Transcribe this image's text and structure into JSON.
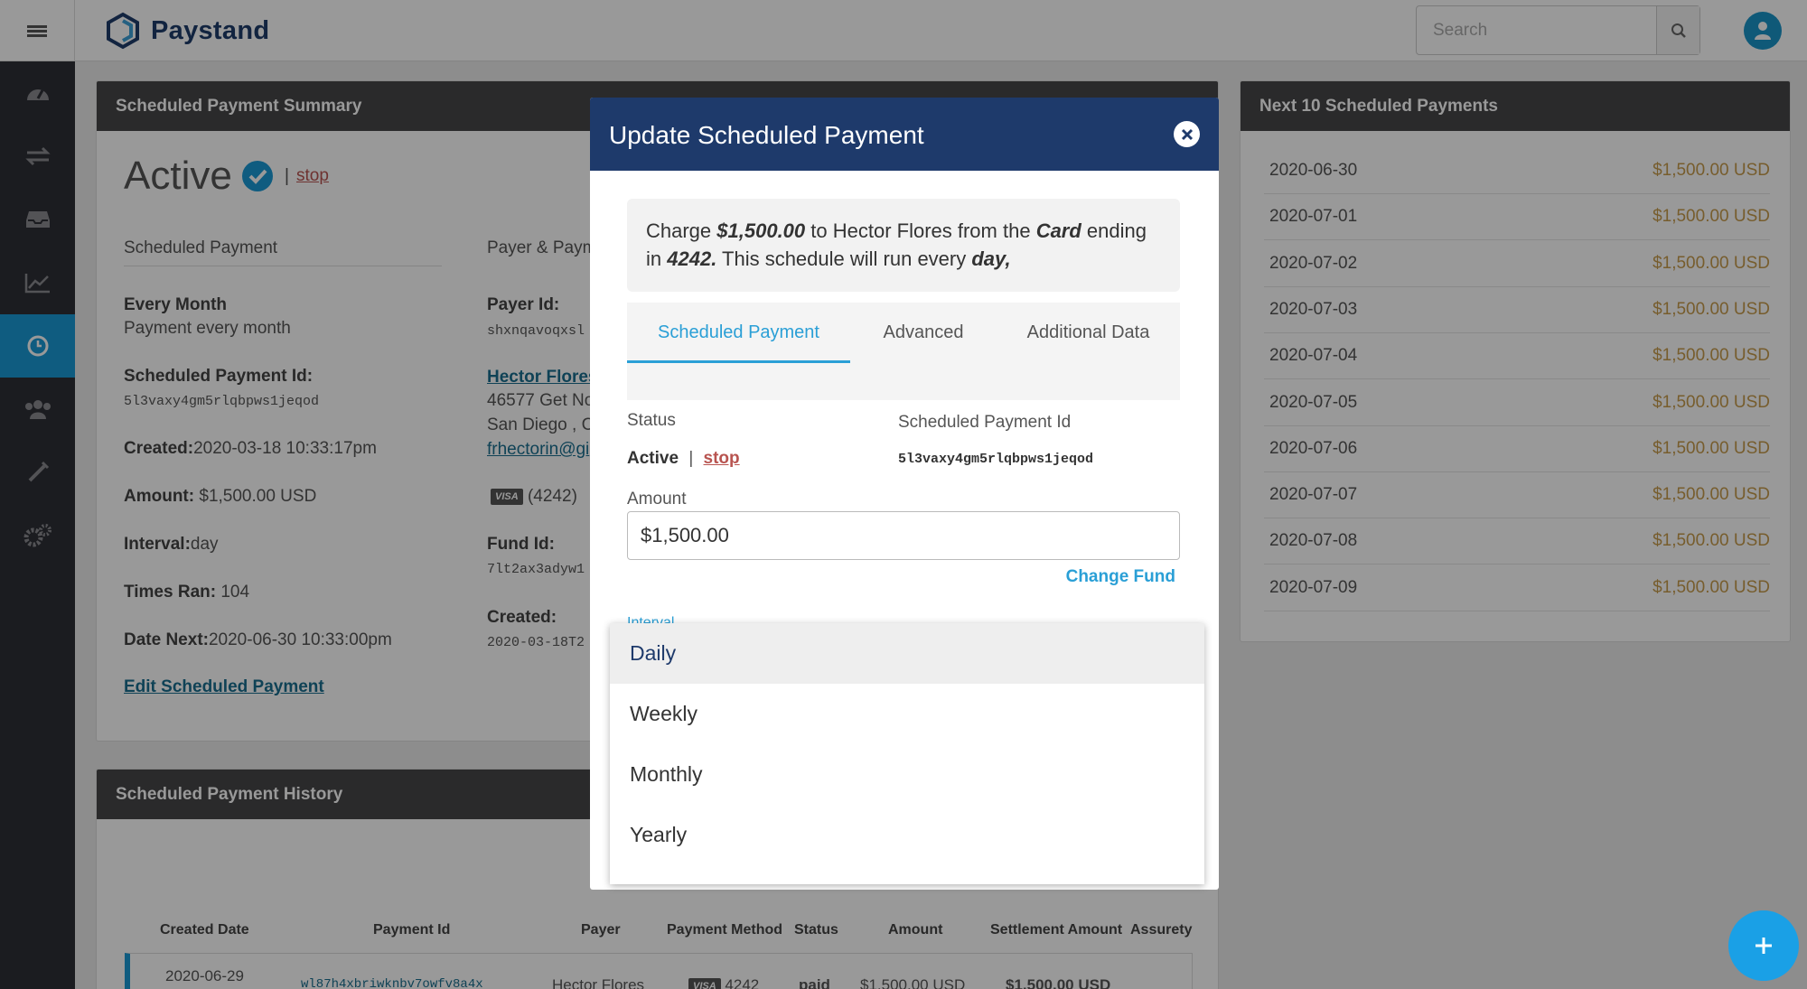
{
  "app": {
    "brand": "Paystand"
  },
  "search": {
    "placeholder": "Search"
  },
  "sidebar": {
    "items": [
      "dashboard-icon",
      "transfers-icon",
      "inbox-icon",
      "chart-icon",
      "clock-icon",
      "users-icon",
      "tools-icon",
      "settings-icon"
    ]
  },
  "summary": {
    "title": "Scheduled Payment Summary",
    "status": "Active",
    "stop": "stop",
    "col1_head": "Scheduled Payment",
    "col2_head": "Payer & Paym",
    "interval_title": "Every Month",
    "interval_desc": "Payment every month",
    "sp_id_label": "Scheduled Payment Id:",
    "sp_id": "5l3vaxy4gm5rlqbpws1jeqod",
    "created_label": "Created:",
    "created": "2020-03-18 10:33:17pm",
    "amount_label": "Amount:",
    "amount": " $1,500.00 USD",
    "interval_label": "Interval:",
    "interval": "day",
    "times_label": "Times Ran:",
    "times": " 104",
    "next_label": "Date Next:",
    "next": "2020-06-30 10:33:00pm",
    "edit_link": "Edit Scheduled Payment",
    "payer_id_label": "Payer Id:",
    "payer_id": "shxnqavoqxsl",
    "payer_name": "Hector Flores",
    "address1": "46577 Get No",
    "address2": "San Diego , CA",
    "email": "frhectorin@gi",
    "card_brand": "VISA",
    "card_last": "(4242)",
    "fund_id_label": "Fund Id:",
    "fund_id": "7lt2ax3adyw1",
    "created2_label": "Created:",
    "created2": "2020-03-18T2"
  },
  "history": {
    "title": "Scheduled Payment History",
    "headers": [
      "Created Date",
      "Payment Id",
      "Payer",
      "Payment Method",
      "Status",
      "Amount",
      "Settlement Amount",
      "Assurety"
    ],
    "row": {
      "date": "2020-06-29",
      "payment_id": "wl87h4xbriwknbv7owfv8a4x",
      "payer": "Hector Flores",
      "method": "4242",
      "status": "paid",
      "amount": "$1,500.00 USD",
      "settlement": "$1,500.00 USD"
    }
  },
  "next": {
    "title": "Next 10 Scheduled Payments",
    "rows": [
      {
        "date": "2020-06-30",
        "amount": "$1,500.00 USD"
      },
      {
        "date": "2020-07-01",
        "amount": "$1,500.00 USD"
      },
      {
        "date": "2020-07-02",
        "amount": "$1,500.00 USD"
      },
      {
        "date": "2020-07-03",
        "amount": "$1,500.00 USD"
      },
      {
        "date": "2020-07-04",
        "amount": "$1,500.00 USD"
      },
      {
        "date": "2020-07-05",
        "amount": "$1,500.00 USD"
      },
      {
        "date": "2020-07-06",
        "amount": "$1,500.00 USD"
      },
      {
        "date": "2020-07-07",
        "amount": "$1,500.00 USD"
      },
      {
        "date": "2020-07-08",
        "amount": "$1,500.00 USD"
      },
      {
        "date": "2020-07-09",
        "amount": "$1,500.00 USD"
      }
    ]
  },
  "modal": {
    "title": "Update Scheduled Payment",
    "charge_text_1": "Charge ",
    "charge_amount": "$1,500.00",
    "charge_text_2": " to Hector Flores from the ",
    "charge_card": "Card",
    "charge_text_3": " ending in ",
    "charge_last": "4242.",
    "charge_text_4": "  This schedule will run every ",
    "charge_interval": "day,",
    "tabs": [
      "Scheduled Payment",
      "Advanced",
      "Additional Data"
    ],
    "status_label": "Status",
    "status": "Active",
    "sep": "|",
    "stop": "stop",
    "sp_id_label": "Scheduled Payment Id",
    "sp_id": "5l3vaxy4gm5rlqbpws1jeqod",
    "amount_label": "Amount",
    "amount_value": "$1,500.00",
    "change_fund": "Change Fund",
    "interval_label": "Interval"
  },
  "dropdown": {
    "options": [
      "Daily",
      "Weekly",
      "Monthly",
      "Yearly"
    ],
    "selected": "Daily"
  },
  "colors": {
    "primary": "#1e3a6b",
    "accent": "#2a9fd6",
    "amount_gold": "#c69b4c",
    "sidebar": "#2e2f36"
  }
}
